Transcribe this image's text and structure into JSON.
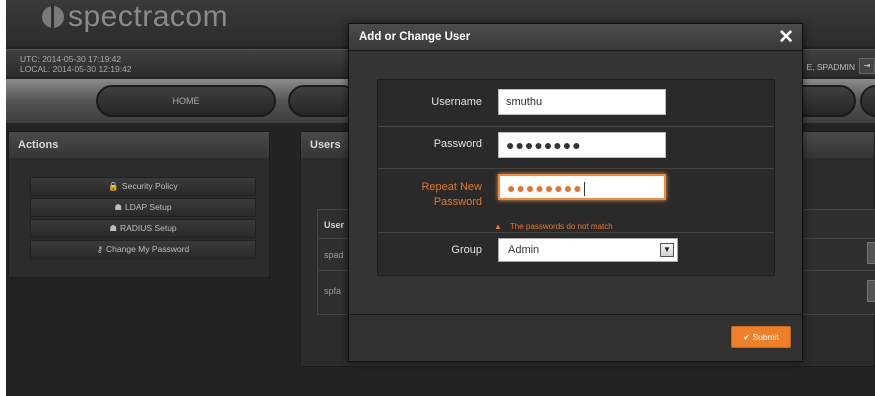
{
  "brand": {
    "logo_text": "spectracom"
  },
  "status": {
    "utc": "UTC: 2014-05-30 17:19:42",
    "local": "LOCAL: 2014-05-30 12:19:42",
    "user": "E, SPADMIN"
  },
  "nav": {
    "home_label": "HOME"
  },
  "actions": {
    "title": "Actions",
    "items": [
      {
        "icon": "lock-icon",
        "glyph": "🔒",
        "label": "Security Policy"
      },
      {
        "icon": "users-icon",
        "glyph": "☗",
        "label": "LDAP Setup"
      },
      {
        "icon": "users-icon",
        "glyph": "☗",
        "label": "RADIUS Setup"
      },
      {
        "icon": "key-icon",
        "glyph": "⚷",
        "label": "Change My Password"
      }
    ]
  },
  "users_panel": {
    "title": "Users",
    "header": "User",
    "rows": [
      "spad",
      "spfa"
    ]
  },
  "modal": {
    "title": "Add or Change User",
    "close_glyph": "✕",
    "username": {
      "label": "Username",
      "value": "smuthu"
    },
    "password": {
      "label": "Password",
      "value": "●●●●●●●●"
    },
    "repeat_password": {
      "label_line1": "Repeat New",
      "label_line2": "Password",
      "value": "●●●●●●●●",
      "error": "The passwords do not match"
    },
    "group": {
      "label": "Group",
      "value": "Admin",
      "options": [
        "Admin"
      ]
    },
    "submit_label": "Submit",
    "submit_glyph": "✔"
  },
  "colors": {
    "accent": "#f07f28",
    "error": "#e27532",
    "background": "#232323"
  }
}
